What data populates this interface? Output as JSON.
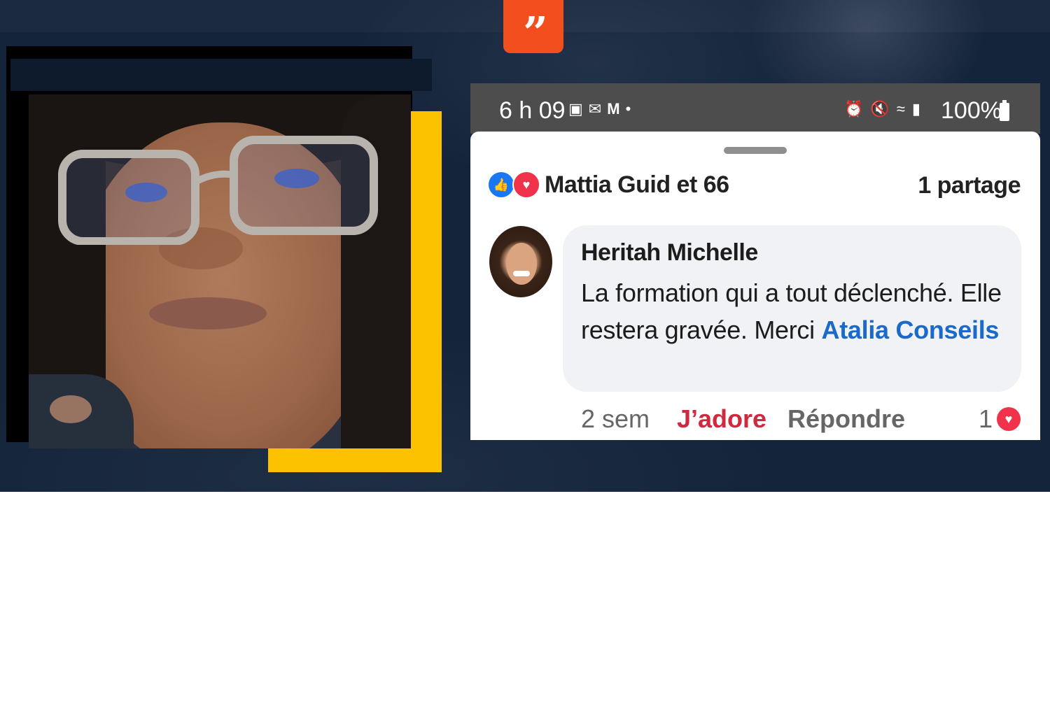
{
  "quote_mark": "”",
  "phone_status": {
    "time": "6 h 09",
    "left_icons": [
      "image-icon",
      "mail-icon",
      "gmail-icon",
      "dot-icon"
    ],
    "right_icons": [
      "alarm-icon",
      "mute-icon",
      "wifi-icon",
      "signal-icon"
    ],
    "battery": "100%"
  },
  "post": {
    "reactions_text": "Mattia Guid et 66",
    "shares": "1 partage"
  },
  "comment": {
    "author": "Heritah Michelle",
    "text": "La formation qui a tout déclenché. Elle restera gravée. Merci ",
    "mention": "Atalia Conseils",
    "time": "2 sem",
    "like_label": "J’adore",
    "reply_label": "Répondre",
    "reaction_count": "1"
  },
  "colors": {
    "banner": "#14243a",
    "accent_orange": "#f24e1e",
    "accent_yellow": "#fcc200",
    "facebook_blue": "#1877f2",
    "love_red": "#f0334b",
    "mention_blue": "#1b6ac9"
  }
}
